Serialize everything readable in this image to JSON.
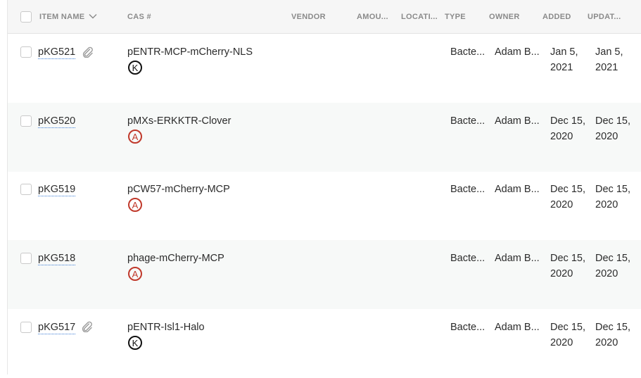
{
  "columns": {
    "item_name": "ITEM NAME",
    "cas": "CAS #",
    "vendor": "VENDOR",
    "amount": "AMOU...",
    "location": "LOCATI...",
    "type": "TYPE",
    "owner": "OWNER",
    "added": "ADDED",
    "updated": "UPDAT..."
  },
  "rows": [
    {
      "name": "pKG521",
      "has_attachment": true,
      "cas": "pENTR-MCP-mCherry-NLS",
      "badge": "K",
      "type": "Bacte...",
      "owner": "Adam B...",
      "added_1": "Jan 5,",
      "added_2": "2021",
      "updated_1": "Jan 5,",
      "updated_2": "2021"
    },
    {
      "name": "pKG520",
      "has_attachment": false,
      "cas": "pMXs-ERKKTR-Clover",
      "badge": "A",
      "type": "Bacte...",
      "owner": "Adam B...",
      "added_1": "Dec 15,",
      "added_2": "2020",
      "updated_1": "Dec 15,",
      "updated_2": "2020"
    },
    {
      "name": "pKG519",
      "has_attachment": false,
      "cas": "pCW57-mCherry-MCP",
      "badge": "A",
      "type": "Bacte...",
      "owner": "Adam B...",
      "added_1": "Dec 15,",
      "added_2": "2020",
      "updated_1": "Dec 15,",
      "updated_2": "2020"
    },
    {
      "name": "pKG518",
      "has_attachment": false,
      "cas": "phage-mCherry-MCP",
      "badge": "A",
      "type": "Bacte...",
      "owner": "Adam B...",
      "added_1": "Dec 15,",
      "added_2": "2020",
      "updated_1": "Dec 15,",
      "updated_2": "2020"
    },
    {
      "name": "pKG517",
      "has_attachment": true,
      "cas": "pENTR-Isl1-Halo",
      "badge": "K",
      "type": "Bacte...",
      "owner": "Adam B...",
      "added_1": "Dec 15,",
      "added_2": "2020",
      "updated_1": "Dec 15,",
      "updated_2": "2020"
    }
  ],
  "colors": {
    "badge_k": "#111111",
    "badge_a": "#c0392b",
    "link_underline": "#3a7bd5"
  }
}
